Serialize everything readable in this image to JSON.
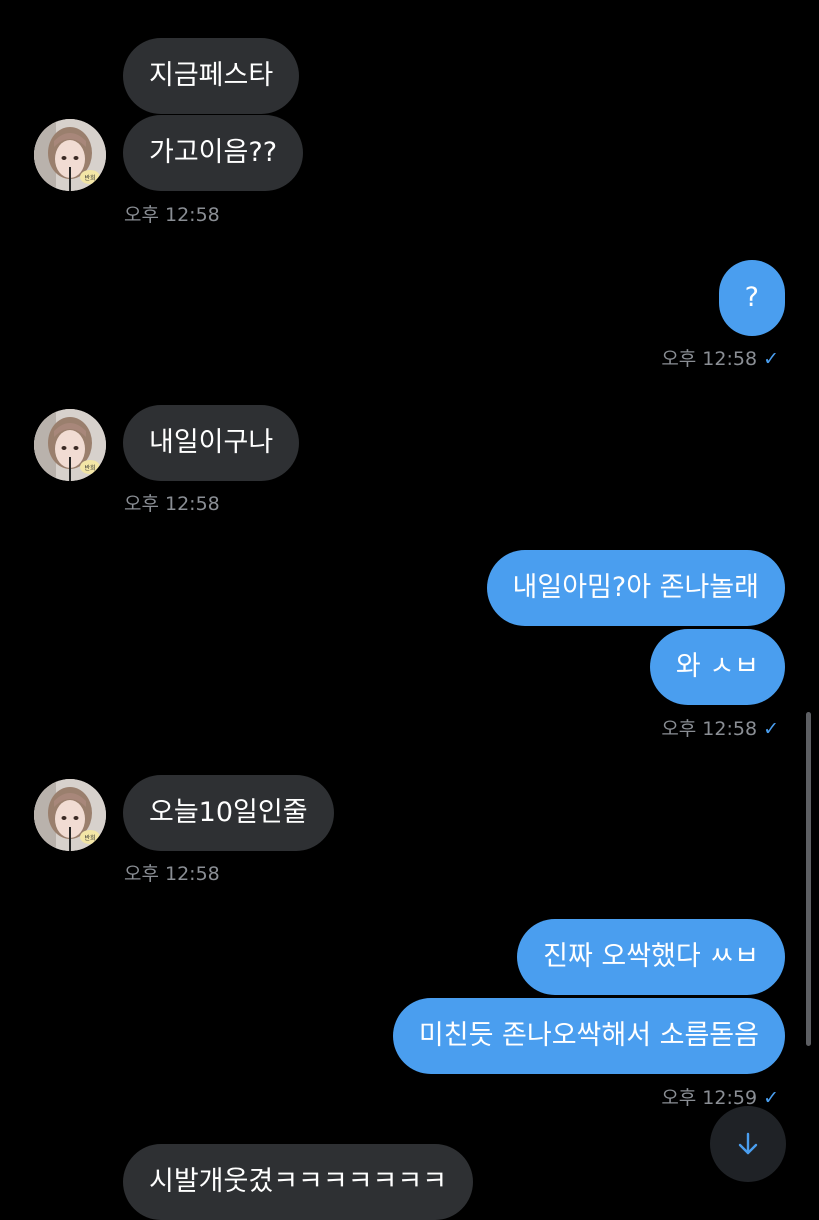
{
  "messages": [
    {
      "dir": "in",
      "text": "지금페스타"
    },
    {
      "dir": "in",
      "text": "가고이음??"
    },
    {
      "time_in_1": "오후 12:58"
    },
    {
      "dir": "out",
      "text": "?"
    },
    {
      "dir": "in",
      "text": "내일이구나"
    },
    {
      "dir": "out",
      "text": "내일아밈?아 존나놀래"
    },
    {
      "dir": "out",
      "text": "와 ㅅㅂ"
    },
    {
      "dir": "in",
      "text": "오늘10일인줄"
    },
    {
      "dir": "out",
      "text": "진짜 오싹했다 ㅆㅂ"
    },
    {
      "dir": "out",
      "text": "미친듯 존나오싹해서 소름돋음"
    },
    {
      "dir": "in",
      "text": "시발개웃겼ㅋㅋㅋㅋㅋㅋㅋ"
    }
  ],
  "times": {
    "t1": "오후 12:58",
    "t2": "오후 12:58",
    "t3": "오후 12:58",
    "t4": "오후 12:58",
    "t5": "오후 12:58",
    "t6": "오후 12:59"
  },
  "avatar_badge": "반희",
  "read_check": "✓",
  "icons": {
    "scroll_down": "arrow-down-icon",
    "read_receipt": "check-icon"
  },
  "colors": {
    "background": "#000000",
    "incoming_bubble": "#2e3033",
    "outgoing_bubble": "#4a9eef",
    "timestamp": "#8a8e94",
    "accent": "#4a9eef"
  }
}
